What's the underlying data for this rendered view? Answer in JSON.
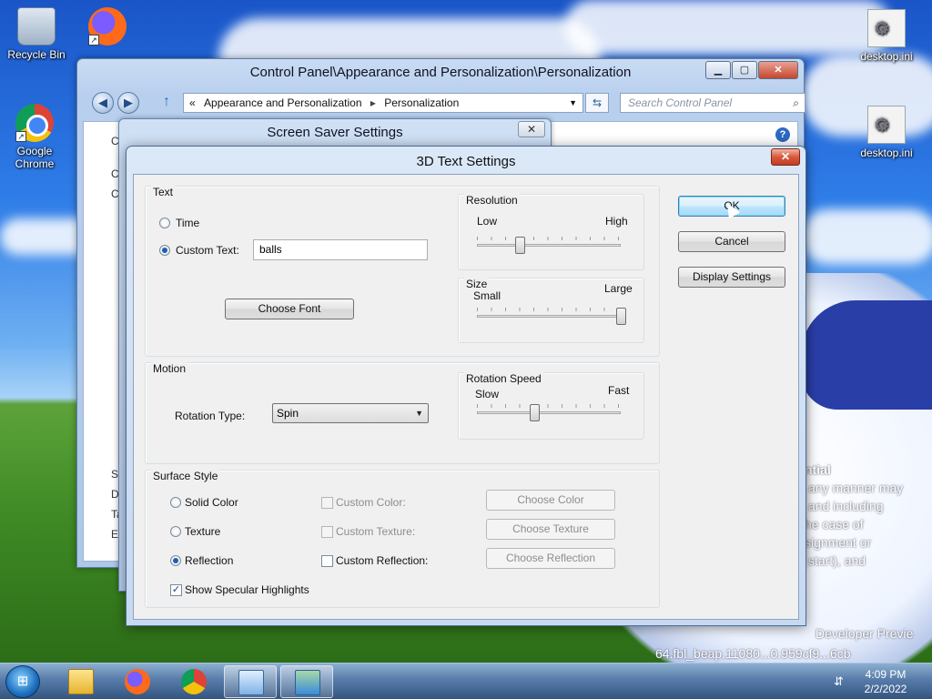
{
  "desktop": {
    "icons": [
      {
        "label": "Recycle Bin"
      },
      {
        "label": "Firefox"
      },
      {
        "label": "Google Chrome"
      },
      {
        "label": "desktop.ini"
      },
      {
        "label": "desktop.ini"
      }
    ],
    "overlay_lines": [
      "ntial",
      "any manner may",
      "and including",
      "he case of",
      "signment or",
      "start), and",
      "Developer Previe",
      "64.fbl_beap.11080...0.959cf9...6cb"
    ]
  },
  "control_panel": {
    "title": "Control Panel\\Appearance and Personalization\\Personalization",
    "address": {
      "root_marker": "«",
      "crumb1": "Appearance and Personalization",
      "separator": "▸",
      "crumb2": "Personalization"
    },
    "search_placeholder": "Search Control Panel",
    "side_letters": [
      "C",
      "C",
      "C",
      "Se",
      "D",
      "Ta",
      "Ea"
    ],
    "buttons": {
      "minimize": "▁",
      "maximize": "▢",
      "close": "✕"
    }
  },
  "screen_saver": {
    "title": "Screen Saver Settings",
    "close": "✕"
  },
  "dialog": {
    "title": "3D Text Settings",
    "close": "✕",
    "text_group": {
      "label": "Text",
      "time_label": "Time",
      "custom_text_label": "Custom Text:",
      "custom_text_value": "balls",
      "choose_font": "Choose Font",
      "selected": "custom_text"
    },
    "resolution": {
      "label": "Resolution",
      "low": "Low",
      "high": "High",
      "level": 0.3
    },
    "size": {
      "label": "Size",
      "small": "Small",
      "large": "Large",
      "level": 1.0
    },
    "motion": {
      "label": "Motion",
      "rotation_type_label": "Rotation Type:",
      "rotation_type_value": "Spin"
    },
    "rotation_speed": {
      "label": "Rotation Speed",
      "slow": "Slow",
      "fast": "Fast",
      "level": 0.4
    },
    "surface": {
      "label": "Surface Style",
      "solid_color": "Solid Color",
      "texture": "Texture",
      "reflection": "Reflection",
      "custom_color": "Custom Color:",
      "custom_texture": "Custom Texture:",
      "custom_reflection": "Custom Reflection:",
      "choose_color": "Choose Color",
      "choose_texture": "Choose Texture",
      "choose_reflection": "Choose Reflection",
      "specular": "Show Specular Highlights",
      "selected": "reflection",
      "specular_checked": true
    },
    "buttons": {
      "ok": "OK",
      "cancel": "Cancel",
      "display_settings": "Display Settings"
    }
  },
  "taskbar": {
    "start_glyph": "⊞",
    "time": "4:09 PM",
    "date": "2/2/2022",
    "tray_glyph": "⇵"
  }
}
